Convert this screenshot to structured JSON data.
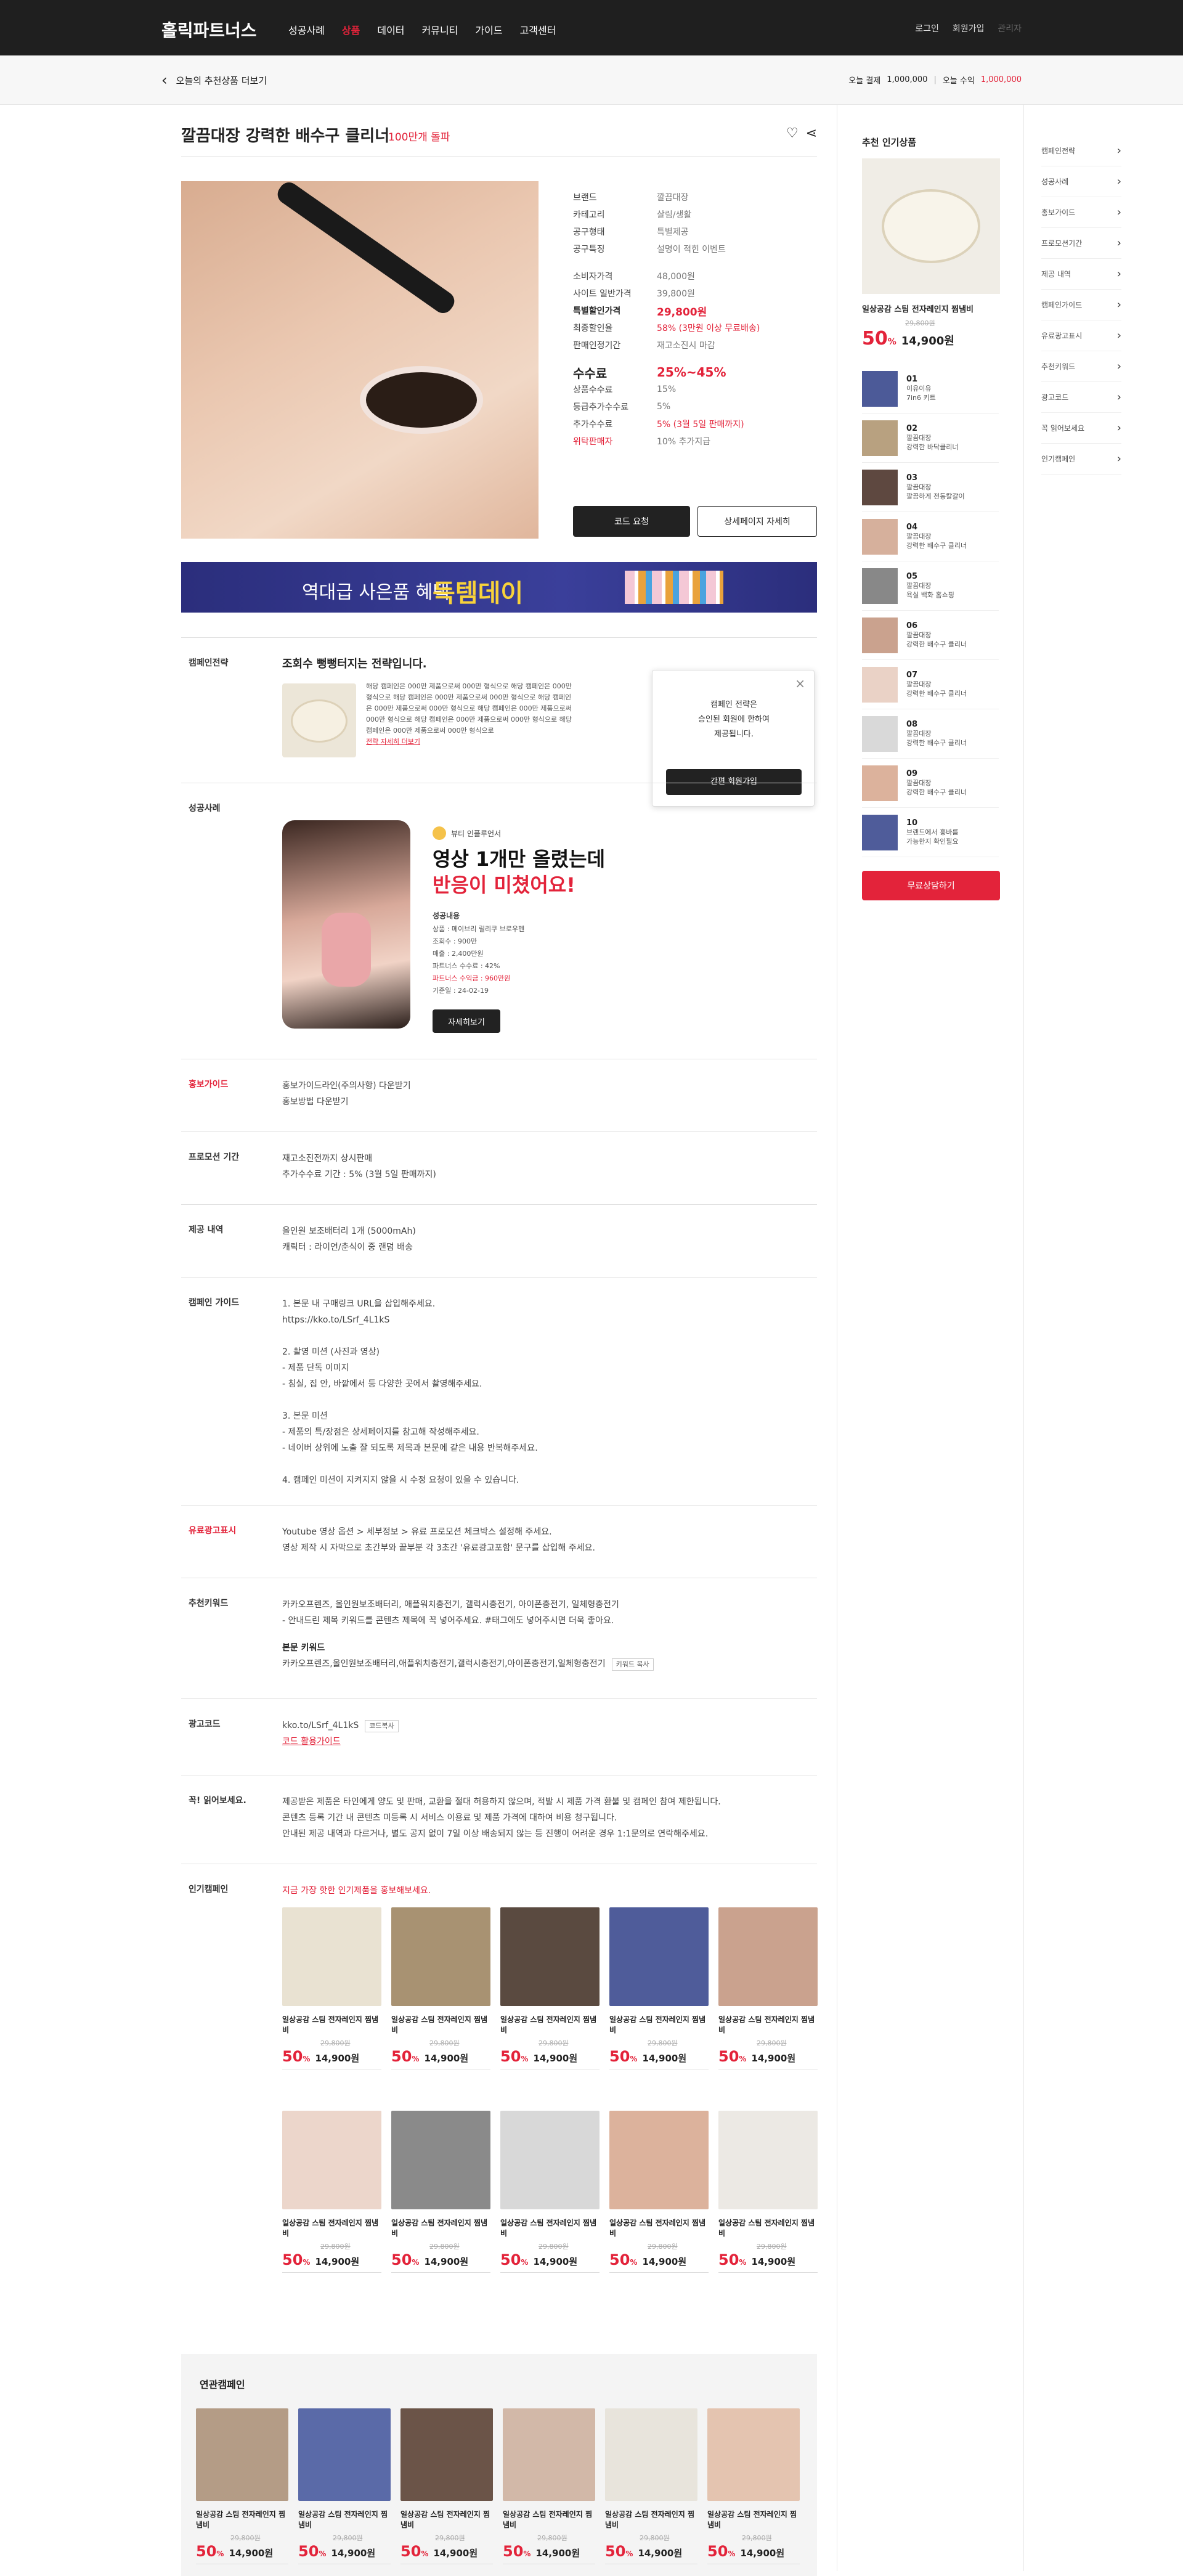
{
  "header": {
    "logo": "홀릭파트너스",
    "menu": [
      "성공사례",
      "상품",
      "데이터",
      "커뮤니티",
      "가이드",
      "고객센터"
    ],
    "active_index": 1,
    "login": "로그인",
    "signup": "회원가입",
    "mypage": "관리자"
  },
  "subbar": {
    "back_text": "오늘의 추천상품 더보기",
    "stat1_label": "오늘 결제",
    "stat1_value": "1,000,000",
    "stat2_label": "오늘 수익",
    "stat2_value": "1,000,000"
  },
  "product": {
    "title": "깔끔대장 강력한 배수구 클리너",
    "tag": "100만개 돌파",
    "info": [
      {
        "k": "브랜드",
        "v": "깔끔대장"
      },
      {
        "k": "카테고리",
        "v": "살림/생활"
      },
      {
        "k": "공구형태",
        "v": "특별제공"
      },
      {
        "k": "공구특징",
        "v": "설명이 적힌 이벤트"
      }
    ],
    "price": [
      {
        "k": "소비자가격",
        "v": "48,000원"
      },
      {
        "k": "사이트 일반가격",
        "v": "39,800원"
      },
      {
        "k": "특별할인가격",
        "v": "29,800원"
      },
      {
        "k": "최종할인율",
        "v": "58% (3만원 이상 무료배송)"
      },
      {
        "k": "판매인정기간",
        "v": "재고소진시 마감"
      }
    ],
    "fee_title": "수수료",
    "fee_range": "25%~45%",
    "fee": [
      {
        "k": "상품수수료",
        "v": "15%"
      },
      {
        "k": "등급추가수수료",
        "v": "5%"
      },
      {
        "k": "추가수수료",
        "v": "5% (3월 5일 판매까지)"
      },
      {
        "k": "위탁판매자",
        "v": "10% 추가지급"
      }
    ],
    "btn_code": "코드 요청",
    "btn_detail": "상세페이지 자세히"
  },
  "banner": {
    "text1": "역대급 사은품 혜택",
    "text2": "득템데이"
  },
  "campaign": {
    "label": "캠페인전략",
    "title": "조회수 뻥뻥터지는 전략입니다.",
    "body": "해당 캠페인은 000만 제품으로써 000만 형식으로 해당 캠페인은 000만 형식으로 해당 캠페인은 000만 제품으로써 000만 형식으로 해당 캠페인은 000만 제품으로써 000만 형식으로 해당 캠페인은 000만 제품으로써 000만 형식으로 해당 캠페인은 000만 제품으로써 000만 형식으로 해당 캠페인은 000만 제품으로써 000만 형식으로",
    "more": "전략 자세히 더보기",
    "popup_msg1": "캠페인 전략은",
    "popup_msg2": "승인된 회원에 한하여",
    "popup_msg3": "제공됩니다.",
    "popup_btn": "간편 회원가입"
  },
  "success": {
    "label": "성공사례",
    "author": "뷰티 인플루언서",
    "h1": "영상 1개만 올렸는데",
    "h2": "반응이 미쳤어요!",
    "sub": "성공내용",
    "lines": [
      "상품 : 메이브리 릴리쿠 브로우펜",
      "조회수 : 900만",
      "매출 : 2,400만원",
      "파트너스 수수료 : 42%",
      "파트너스 수익금 : 960만원",
      "기준일 : 24-02-19"
    ],
    "btn": "자세히보기"
  },
  "promo": {
    "label": "홍보가이드",
    "lines": [
      "홍보가이드라인(주의사항) 다운받기",
      "홍보방법 다운받기"
    ]
  },
  "period": {
    "label": "프로모션 기간",
    "lines": [
      "재고소진전까지 상시판매",
      "추가수수료 기간 : 5% (3월 5일 판매까지)"
    ]
  },
  "provide": {
    "label": "제공 내역",
    "lines": [
      "올인원 보조배터리 1개 (5000mAh)",
      "캐릭터 : 라이언/춘식이 중 랜덤 배송"
    ]
  },
  "guide": {
    "label": "캠페인 가이드",
    "lines": [
      "1. 본문 내  구매링크 URL을 삽입해주세요.",
      "https://kko.to/LSrf_4L1kS",
      "",
      "2. 촬영 미션 (사진과 영상)",
      "- 제품 단독  이미지",
      "- 침실, 집 안, 바깥에서 등 다양한 곳에서 촬영해주세요.",
      "",
      "3. 본문 미션",
      "- 제품의 특/장점은 상세페이지를 참고해 작성해주세요.",
      "- 네이버 상위에 노출 잘 되도록 제목과 본문에 같은 내용 반복해주세요.",
      "",
      "4.  캠페인 미션이  지켜지지 않을 시 수정 요청이 있을 수 있습니다."
    ]
  },
  "ad": {
    "label": "유료광고표시",
    "lines": [
      "Youtube 영상 옵션 > 세부정보  > 유료 프로모션 체크박스 설정해 주세요.",
      "영상 제작 시 자막으로 초간부와 끝부분 각 3초간 '유료광고포함' 문구를 삽입해 주세요."
    ]
  },
  "keyword": {
    "label": "추천키워드",
    "lines": [
      "카카오프렌즈, 올인원보조배터리, 애플워치충전기, 갤럭시충전기, 아이폰충전기, 일체형충전기",
      "- 안내드린 제목  키워드를 콘텐츠 제목에 꼭 넣어주세요. #태그에도 넣어주시면 더욱 좋아요."
    ],
    "sub": "본문 키워드",
    "body": "카카오프렌즈,올인원보조배터리,애플워치충전기,갤럭시충전기,아이폰충전기,일체형충전기",
    "copy": "키워드 복사"
  },
  "adcode": {
    "label": "광고코드",
    "code": "kko.to/LSrf_4L1kS",
    "copy": "코드복사",
    "link": "코드 활용가이드"
  },
  "notice": {
    "label": "꼭! 읽어보세요.",
    "lines": [
      "제공받은 제품은  타인에게 양도 및 판매, 교환을 절대 허용하지 않으며, 적발 시 제품 가격 환불 및 캠페인 참여 제한됩니다.",
      "콘텐츠 등록 기간  내 콘텐츠 미등록 시 서비스 이용료 및 제품 가격에 대하여 비용 청구됩니다.",
      "안내된 제공  내역과 다르거나, 별도 공지 없이 7일 이상 배송되지 않는 등 진행이 어려운 경우 1:1문의로 연락해주세요."
    ]
  },
  "popular": {
    "label": "인기캠페인",
    "sub": "지금 가장 핫한 인기제품을 홍보해보세요.",
    "name": "일상공감 스팀 전자레인지 찜냄비",
    "orig": "29,800원",
    "pct": "50",
    "unit": "%",
    "price": "14,900원",
    "imgs": [
      "#e9e2d2",
      "#a89272",
      "#5a4a40",
      "#4f5c9a",
      "#caa28e",
      "#ecd6cb",
      "#8a8a8a",
      "#d8d8d8",
      "#dcb29c",
      "#ece9e4"
    ]
  },
  "related": {
    "title": "연관캠페인",
    "imgs": [
      "#b49c86",
      "#5a6aa8",
      "#6b5448",
      "#d2b8a8",
      "#e8e4dc",
      "#e4c4b0"
    ]
  },
  "side": {
    "title": "추천 인기상품",
    "name": "일상공감 스팀 전자레인지 찜냄비",
    "orig": "29,800원",
    "pct": "50",
    "unit": "%",
    "price": "14,900원",
    "ranks": [
      {
        "n": "01",
        "t": "이유이유",
        "t2": "7in6 키트",
        "c": "#4c5a98"
      },
      {
        "n": "02",
        "t": "깔끔대장",
        "t2": "강력한 바닥클리너",
        "c": "#b8a180"
      },
      {
        "n": "03",
        "t": "깔끔대장",
        "t2": "깔끔하게 전동칼갈이",
        "c": "#5e4840"
      },
      {
        "n": "04",
        "t": "깔끔대장",
        "t2": "강력한 배수구 클리너",
        "c": "#d6b09c"
      },
      {
        "n": "05",
        "t": "깔끔대장",
        "t2": "욕실 백화 홈쇼핑",
        "c": "#888888"
      },
      {
        "n": "06",
        "t": "깔끔대장",
        "t2": "강력한 배수구 클리너",
        "c": "#caa28e"
      },
      {
        "n": "07",
        "t": "깔끔대장",
        "t2": "강력한 배수구 클리너",
        "c": "#ead2c6"
      },
      {
        "n": "08",
        "t": "깔끔대장",
        "t2": "강력한 배수구 클리너",
        "c": "#d9d9d9"
      },
      {
        "n": "09",
        "t": "깔끔대장",
        "t2": "강력한 배수구 클리너",
        "c": "#dcb29c"
      },
      {
        "n": "10",
        "t": "브랜드에서 홍바름",
        "t2": "가능한지 확인필요",
        "c": "#4f5c9a"
      }
    ],
    "consult": "무료상담하기"
  },
  "rightnav": [
    "캠페인전략",
    "성공사례",
    "홍보가이드",
    "프로모션기간",
    "제공 내역",
    "캠페인가이드",
    "유료광고표시",
    "추천키워드",
    "광고코드",
    "꼭 읽어보세요",
    "인기캠페인"
  ],
  "accent": "#e3233a"
}
